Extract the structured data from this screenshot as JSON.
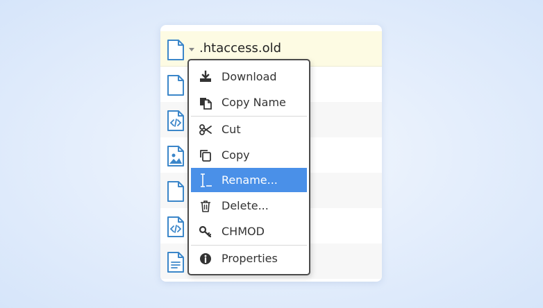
{
  "file_list": {
    "selected_file_name": ".htaccess.old",
    "rows": [
      {
        "icon": "file-blank-icon"
      },
      {
        "icon": "file-code-icon"
      },
      {
        "icon": "file-image-icon"
      },
      {
        "icon": "file-blank-icon"
      },
      {
        "icon": "file-code-icon"
      },
      {
        "icon": "file-text-icon"
      }
    ]
  },
  "context_menu": {
    "items": [
      {
        "label": "Download",
        "icon": "download-icon"
      },
      {
        "label": "Copy Name",
        "icon": "copy-name-icon"
      },
      {
        "label": "Cut",
        "icon": "scissors-icon"
      },
      {
        "label": "Copy",
        "icon": "copy-icon"
      },
      {
        "label": "Rename...",
        "icon": "text-cursor-icon",
        "highlighted": true
      },
      {
        "label": "Delete...",
        "icon": "trash-icon"
      },
      {
        "label": "CHMOD",
        "icon": "key-icon"
      },
      {
        "label": "Properties",
        "icon": "info-icon"
      }
    ]
  },
  "colors": {
    "highlight": "#4a90e8",
    "icon_blue": "#3b86c9",
    "selected_row": "#fdfbe3"
  }
}
